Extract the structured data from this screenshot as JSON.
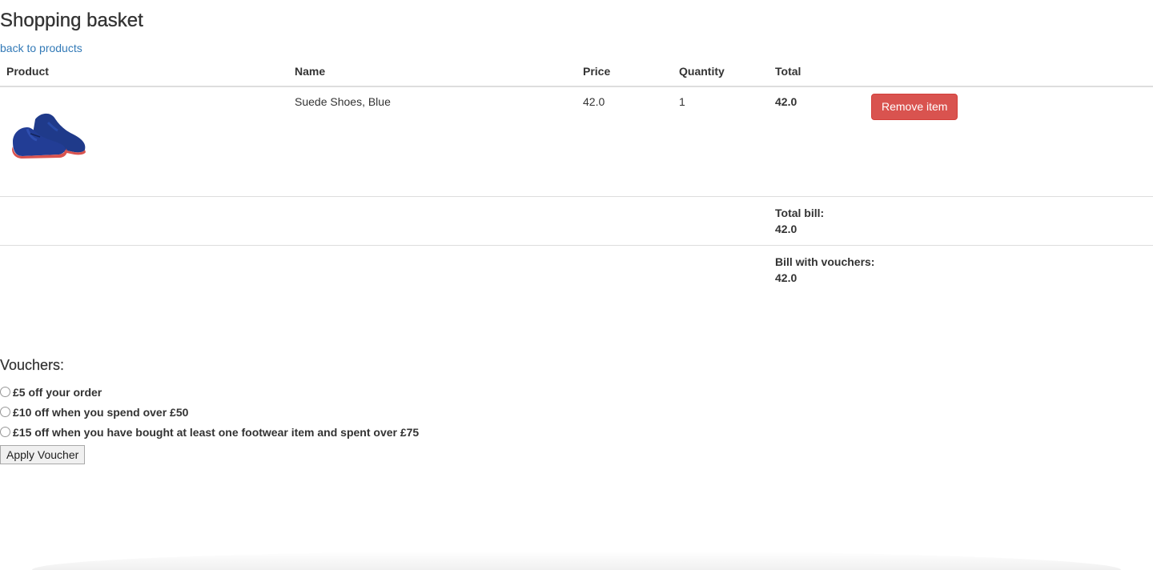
{
  "page": {
    "title": "Shopping basket",
    "back_link": "back to products"
  },
  "table": {
    "headers": [
      "Product",
      "Name",
      "Price",
      "Quantity",
      "Total"
    ],
    "items": [
      {
        "image_icon": "blue-suede-shoe",
        "name": "Suede Shoes, Blue",
        "price": "42.0",
        "quantity": "1",
        "total": "42.0",
        "remove_label": "Remove item"
      }
    ],
    "total_bill_label": "Total bill:",
    "total_bill_value": "42.0",
    "bill_vouchers_label": "Bill with vouchers:",
    "bill_vouchers_value": "42.0"
  },
  "vouchers": {
    "heading": "Vouchers:",
    "options": [
      "£5 off your order",
      "£10 off when you spend over £50",
      "£15 off when you have bought at least one footwear item and spent over £75"
    ],
    "apply_label": "Apply Voucher"
  },
  "colors": {
    "link": "#337ab7",
    "danger": "#d9534f",
    "text": "#333333"
  }
}
